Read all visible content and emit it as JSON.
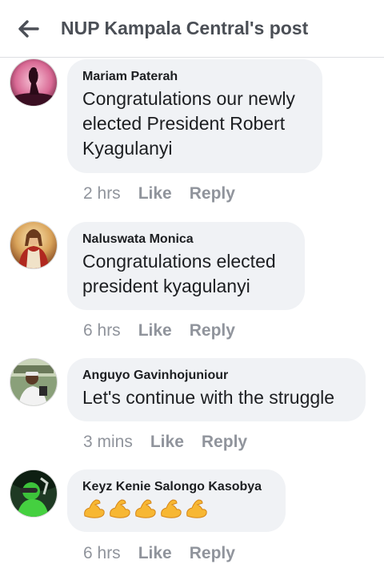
{
  "header": {
    "back_icon": "arrow-left-icon",
    "title": "NUP Kampala Central's post"
  },
  "comments": [
    {
      "author": "Mariam Paterah",
      "text": "Congratulations our newly elected President Robert Kyagulanyi",
      "time": "2 hrs",
      "like_label": "Like",
      "reply_label": "Reply"
    },
    {
      "author": "Naluswata Monica",
      "text": "Congratulations elected president kyagulanyi",
      "time": "6 hrs",
      "like_label": "Like",
      "reply_label": "Reply"
    },
    {
      "author": "Anguyo Gavinhojuniour",
      "text": "Let's continue with the struggle",
      "time": "3 mins",
      "like_label": "Like",
      "reply_label": "Reply"
    },
    {
      "author": "Keyz Kenie Salongo Kasobya",
      "emoji": "flexed-biceps-icon",
      "emoji_count": 5,
      "time": "6 hrs",
      "like_label": "Like",
      "reply_label": "Reply"
    }
  ]
}
